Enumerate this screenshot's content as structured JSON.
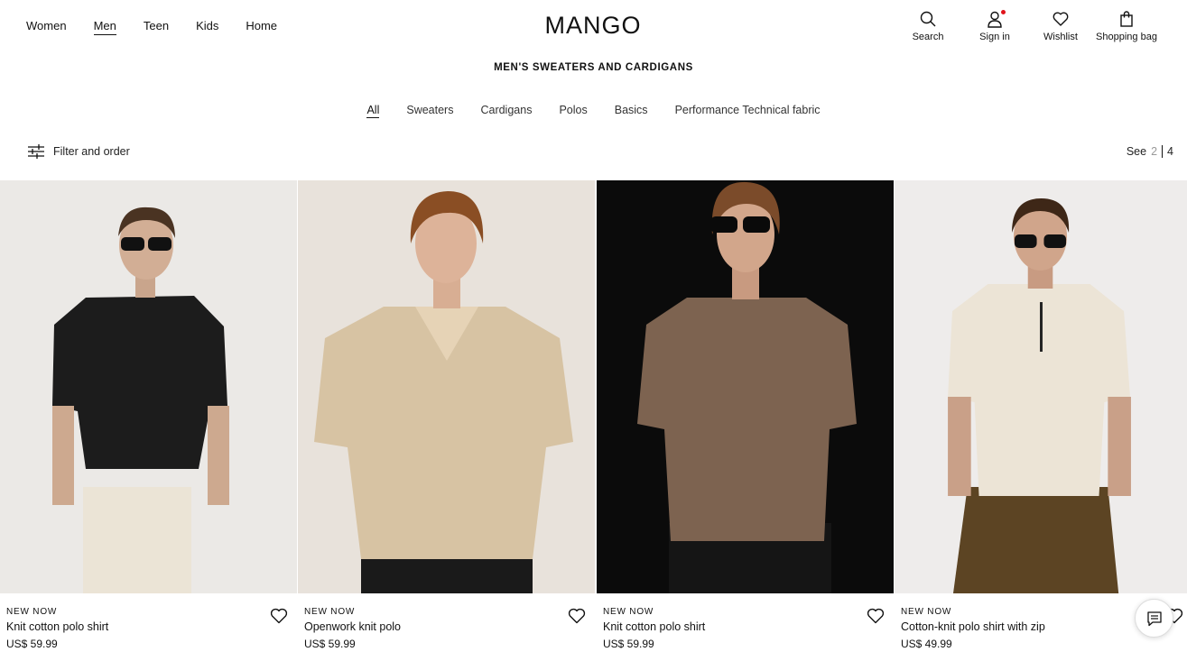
{
  "nav": {
    "categories": [
      {
        "label": "Women",
        "active": false
      },
      {
        "label": "Men",
        "active": true
      },
      {
        "label": "Teen",
        "active": false
      },
      {
        "label": "Kids",
        "active": false
      },
      {
        "label": "Home",
        "active": false
      }
    ],
    "logo": "MANGO",
    "utilities": {
      "search": {
        "label": "Search",
        "icon": "search-icon"
      },
      "signin": {
        "label": "Sign in",
        "icon": "user-icon"
      },
      "wishlist": {
        "label": "Wishlist",
        "icon": "heart-icon"
      },
      "bag": {
        "label": "Shopping bag",
        "icon": "bag-icon"
      }
    },
    "notification_color": "#e0131b"
  },
  "page": {
    "title": "MEN'S SWEATERS AND CARDIGANS",
    "subcategories": [
      {
        "label": "All",
        "active": true
      },
      {
        "label": "Sweaters",
        "active": false
      },
      {
        "label": "Cardigans",
        "active": false
      },
      {
        "label": "Polos",
        "active": false
      },
      {
        "label": "Basics",
        "active": false
      },
      {
        "label": "Performance Technical fabric",
        "active": false
      }
    ],
    "filter_label": "Filter and order",
    "see": {
      "label": "See",
      "option_a": "2",
      "option_b": "4"
    }
  },
  "products": [
    {
      "tag": "NEW NOW",
      "name": "Knit cotton polo shirt",
      "price": "US$ 59.99",
      "shirt_color": "#1c1c1c",
      "background": "#ebe9e6"
    },
    {
      "tag": "NEW NOW",
      "name": "Openwork knit polo",
      "price": "US$ 59.99",
      "shirt_color": "#d7c3a3",
      "background": "#e8e2db"
    },
    {
      "tag": "NEW NOW",
      "name": "Knit cotton polo shirt",
      "price": "US$ 59.99",
      "shirt_color": "#7d6350",
      "background": "#0b0b0b"
    },
    {
      "tag": "NEW NOW",
      "name": "Cotton-knit polo shirt with zip",
      "price": "US$ 49.99",
      "shirt_color": "#ece4d6",
      "background": "#eeeceb"
    }
  ],
  "chat": {
    "icon": "chat-icon"
  }
}
